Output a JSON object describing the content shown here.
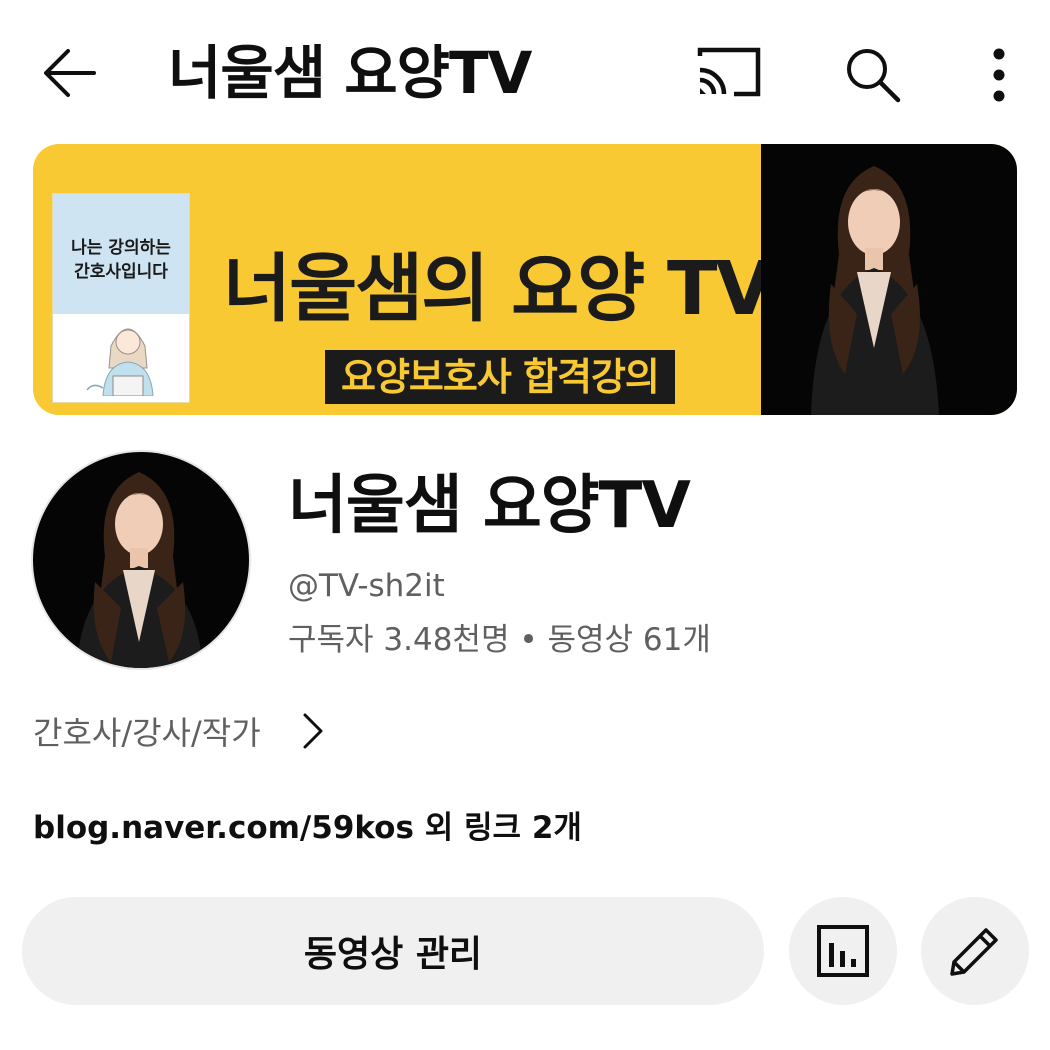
{
  "header": {
    "title": "너울샘 요양TV",
    "back_icon": "arrow-left-icon",
    "cast_icon": "cast-icon",
    "search_icon": "search-icon",
    "more_icon": "more-vertical-icon"
  },
  "banner": {
    "book_small_text": "",
    "book_title_line1": "나는 강의하는",
    "book_title_line2": "간호사입니다",
    "main_text": "너울샘의 요양 TV",
    "sub_text": "요양보호사 합격강의",
    "background_color": "#f9c934"
  },
  "channel": {
    "name": "너울샘 요양TV",
    "handle": "@TV-sh2it",
    "stats": "구독자 3.48천명 • 동영상 61개",
    "description": "간호사/강사/작가",
    "links": "blog.naver.com/59kos 외 링크 2개"
  },
  "actions": {
    "manage_videos": "동영상 관리",
    "analytics_icon": "analytics-icon",
    "edit_icon": "pencil-icon"
  }
}
